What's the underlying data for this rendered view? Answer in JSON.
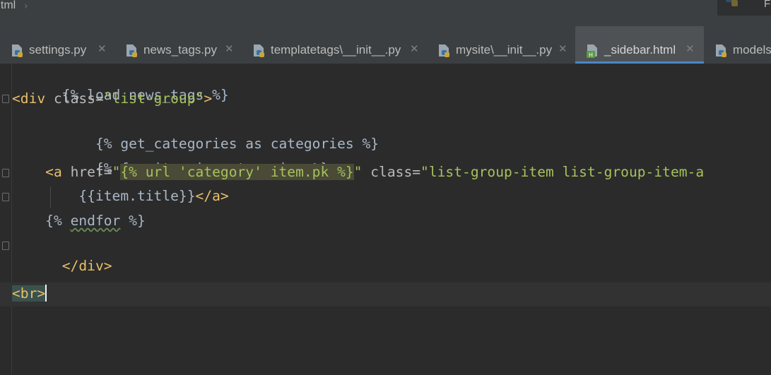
{
  "window": {
    "breadcrumb": "html",
    "top_right_letter": "F"
  },
  "tabs": [
    {
      "label": "settings.py",
      "icon": "python-file-icon"
    },
    {
      "label": "news_tags.py",
      "icon": "python-file-icon"
    },
    {
      "label": "templatetags\\__init__.py",
      "icon": "python-file-icon"
    },
    {
      "label": "mysite\\__init__.py",
      "icon": "python-file-icon"
    },
    {
      "label": "_sidebar.html",
      "icon": "html-file-icon",
      "active": true
    },
    {
      "label": "models",
      "icon": "python-file-icon"
    }
  ],
  "editor": {
    "lines": {
      "l1": "{% load news_tags %}",
      "l2_open": "<div",
      "l2_attr": " class=",
      "l2_str": "\"list-group\"",
      "l2_close": ">",
      "l3": "    {% get_categories as categories %}",
      "l4": "    {% for item in categories %}",
      "l5_open": "    <a",
      "l5_attr": " href=",
      "l5_q1": "\"",
      "l5_tpl": "{% url 'category' item.pk %}",
      "l5_q2": "\"",
      "l5_attr2": " class=",
      "l5_str2": "\"list-group-item list-group-item-a",
      "l6_tpl": "        {{item.title}}",
      "l6_tag": "</a>",
      "l7_pre": "    {% ",
      "l7_kw": "endfor",
      "l7_post": " %}",
      "l8": "</div>",
      "l10": "<br>"
    }
  },
  "colors": {
    "background": "#2b2b2b",
    "tag": "#e8bf6a",
    "string": "#a5c25c",
    "text": "#a9b7c6",
    "active_tab_underline": "#4a88c7"
  }
}
